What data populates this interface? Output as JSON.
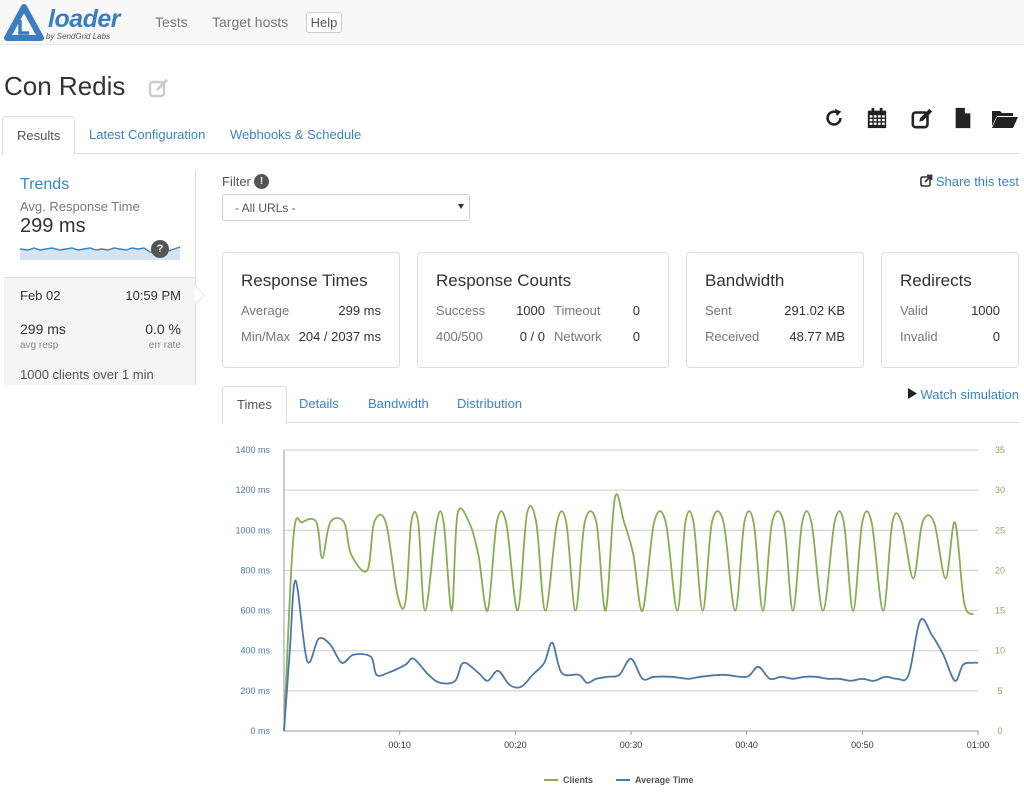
{
  "colors": {
    "link": "#3a84c3",
    "clients": "#8aac52",
    "avg_time": "#4a78a8",
    "grid": "#cccccc"
  },
  "navbar": {
    "logo_text": "loader",
    "logo_sub": "by SendGrid Labs",
    "links": [
      "Tests",
      "Target hosts"
    ],
    "help_label": "Help"
  },
  "page": {
    "title": "Con Redis",
    "edit_icon": "edit-icon"
  },
  "toolbar": {
    "icons": [
      "refresh-icon",
      "calendar-icon",
      "edit-icon",
      "document-icon",
      "folder-open-icon"
    ]
  },
  "tabs": [
    "Results",
    "Latest Configuration",
    "Webhooks & Schedule"
  ],
  "trends": {
    "title": "Trends",
    "subtitle": "Avg. Response Time",
    "value": "299 ms",
    "help_badge": "?",
    "date": "Feb 02",
    "time": "10:59 PM",
    "avg_resp_value": "299 ms",
    "avg_resp_label": "avg resp",
    "err_rate_value": "0.0 %",
    "err_rate_label": "err rate",
    "clients_count": "1000",
    "clients_mid": " clients over ",
    "clients_duration": "1",
    "clients_unit": " min"
  },
  "filter": {
    "label": "Filter",
    "info_badge": "!",
    "selected": "- All URLs -"
  },
  "share_label": "Share this test",
  "stats": {
    "response_times": {
      "title": "Response Times",
      "avg_label": "Average",
      "avg_value": "299 ms",
      "minmax_label": "Min/Max",
      "minmax_value": "204 / 2037 ms"
    },
    "response_counts": {
      "title": "Response Counts",
      "success_label": "Success",
      "success_value": "1000",
      "timeout_label": "Timeout",
      "timeout_value": "0",
      "http_label": "400/500",
      "http_value": "0 / 0",
      "network_label": "Network",
      "network_value": "0"
    },
    "bandwidth": {
      "title": "Bandwidth",
      "sent_label": "Sent",
      "sent_value": "291.02 KB",
      "received_label": "Received",
      "received_value": "48.77 MB"
    },
    "redirects": {
      "title": "Redirects",
      "valid_label": "Valid",
      "valid_value": "1000",
      "invalid_label": "Invalid",
      "invalid_value": "0"
    }
  },
  "subtabs": [
    "Times",
    "Details",
    "Bandwidth",
    "Distribution"
  ],
  "watch_label": "Watch simulation",
  "chart_data": {
    "type": "line",
    "y_left_ticks": [
      "0 ms",
      "200 ms",
      "400 ms",
      "600 ms",
      "800 ms",
      "1000 ms",
      "1200 ms",
      "1400 ms"
    ],
    "y_right_ticks": [
      "0",
      "5",
      "10",
      "15",
      "20",
      "25",
      "30",
      "35"
    ],
    "x_ticks": [
      "00:10",
      "00:20",
      "00:30",
      "00:40",
      "00:50",
      "01:00"
    ],
    "ylim_left": [
      0,
      1400
    ],
    "ylim_right": [
      0,
      35
    ],
    "xlim": [
      0,
      60
    ],
    "grid": true,
    "legend_position": "bottom",
    "series": [
      {
        "name": "Clients",
        "axis": "right",
        "x": [
          0,
          0.8,
          1.6,
          2.8,
          3.3,
          4,
          5.2,
          5.8,
          7.2,
          7.8,
          8.8,
          9.8,
          10.5,
          11,
          11.6,
          12.2,
          13.2,
          13.8,
          14.5,
          15,
          16,
          16.8,
          17.6,
          18.4,
          19.2,
          20.2,
          21,
          21.8,
          22.6,
          23.6,
          24.4,
          25.2,
          26,
          27,
          27.8,
          28.6,
          29.4,
          30.2,
          31,
          32,
          33,
          34,
          34.7,
          35.4,
          36.2,
          37,
          38,
          39,
          39.8,
          40.6,
          41.4,
          42.2,
          43.2,
          44,
          44.8,
          45.6,
          46.6,
          47.6,
          48.4,
          49.2,
          50,
          50.8,
          51.8,
          52.6,
          53.4,
          54.4,
          55.2,
          56.2,
          57.2,
          58,
          58.8,
          59.6
        ],
        "y": [
          0,
          24,
          26,
          26,
          21.5,
          26,
          26,
          22,
          20,
          26,
          26,
          17,
          16,
          26,
          26,
          15,
          26,
          26,
          15,
          27,
          26,
          22,
          15,
          26,
          26,
          15,
          27,
          26,
          15,
          26,
          26,
          15,
          26,
          26,
          15,
          29,
          26,
          22,
          15,
          26,
          26,
          15,
          26,
          26,
          15,
          26,
          26,
          15,
          26,
          26,
          15,
          26,
          26,
          15,
          26,
          26,
          15,
          26,
          26,
          15,
          26,
          26,
          15,
          26,
          26,
          19,
          26,
          26,
          19,
          26,
          16,
          14.5
        ]
      },
      {
        "name": "Average Time",
        "axis": "left",
        "x": [
          0,
          0.5,
          1,
          2,
          3,
          4,
          5,
          6,
          7.5,
          8,
          9,
          10.5,
          11.2,
          12.5,
          13.5,
          14.8,
          15.5,
          16.8,
          17.6,
          18.5,
          19.5,
          20.5,
          21.5,
          22.5,
          23.2,
          24,
          25.5,
          26.2,
          27,
          28,
          29,
          30,
          31,
          32,
          33.5,
          35,
          36,
          38,
          40,
          41,
          42,
          43,
          44,
          45,
          46,
          47,
          48,
          49,
          50,
          51,
          52,
          53,
          54,
          55,
          56,
          57,
          58,
          58.7,
          59.5,
          60
        ],
        "y": [
          0,
          400,
          750,
          350,
          460,
          430,
          340,
          380,
          370,
          280,
          290,
          330,
          360,
          280,
          240,
          250,
          340,
          290,
          250,
          300,
          230,
          220,
          280,
          340,
          440,
          290,
          280,
          240,
          260,
          270,
          280,
          360,
          260,
          270,
          270,
          260,
          270,
          280,
          270,
          320,
          260,
          270,
          260,
          270,
          270,
          260,
          260,
          250,
          260,
          250,
          270,
          260,
          280,
          550,
          480,
          380,
          250,
          330,
          340,
          340
        ]
      }
    ]
  }
}
